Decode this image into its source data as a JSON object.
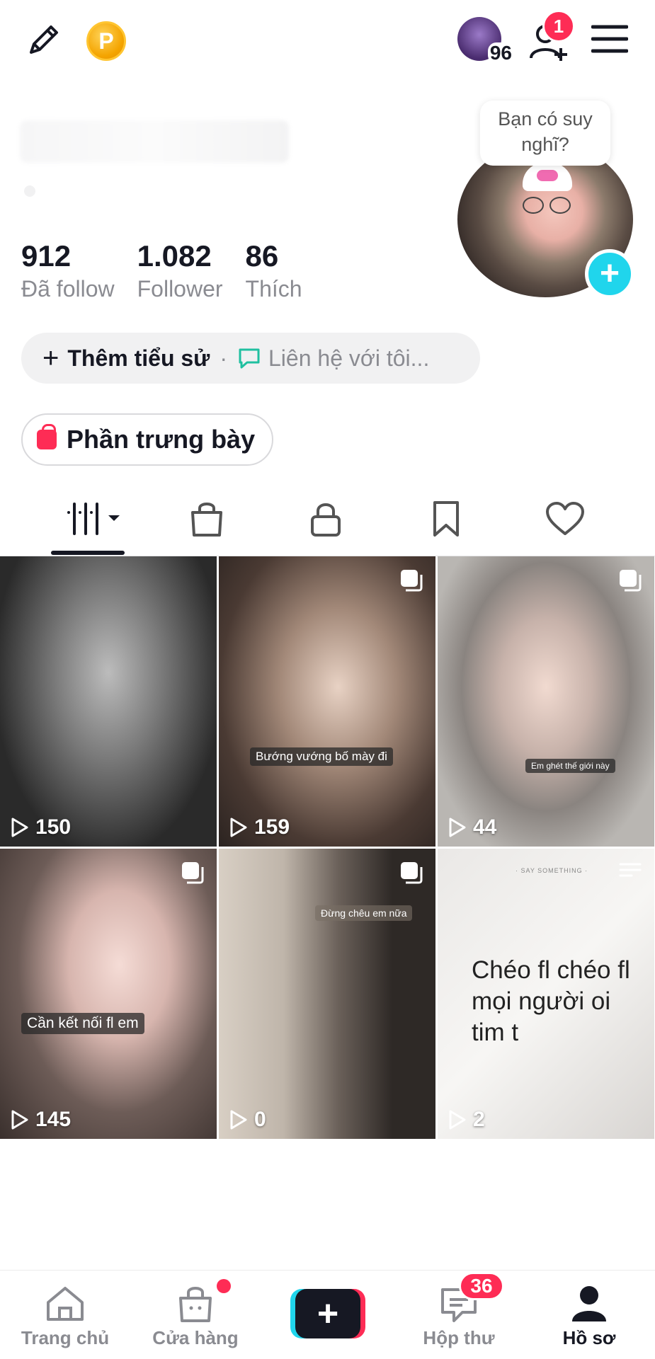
{
  "header": {
    "coin_letter": "P",
    "friends_count": "96",
    "friend_requests_badge": "1"
  },
  "profile": {
    "story_prompt": "Bạn có suy nghĩ?",
    "stats": [
      {
        "value": "912",
        "label": "Đã follow"
      },
      {
        "value": "1.082",
        "label": "Follower"
      },
      {
        "value": "86",
        "label": "Thích"
      }
    ],
    "bio_add_label": "Thêm tiểu sử",
    "bio_separator": "·",
    "contact_label": "Liên hệ với tôi...",
    "showcase_label": "Phần trưng bày"
  },
  "videos": [
    {
      "views": "150"
    },
    {
      "views": "159",
      "caption": "Bướng vướng bố mày đi"
    },
    {
      "views": "44",
      "caption": "Em ghét thế giới này"
    },
    {
      "views": "145",
      "caption": "Cần kết nối fl em"
    },
    {
      "views": "0",
      "caption": "Đừng chêu em nữa"
    },
    {
      "views": "2",
      "small_label": "· SAY SOMETHING ·",
      "text": "Chéo fl chéo fl mọi người oi tim t"
    }
  ],
  "nav": {
    "home": "Trang chủ",
    "shop": "Cửa hàng",
    "inbox": "Hộp thư",
    "inbox_badge": "36",
    "profile": "Hồ sơ"
  },
  "colors": {
    "accent_red": "#fe2c55",
    "accent_cyan": "#20d5ec",
    "text_primary": "#161823",
    "text_secondary": "#8a8b91"
  }
}
